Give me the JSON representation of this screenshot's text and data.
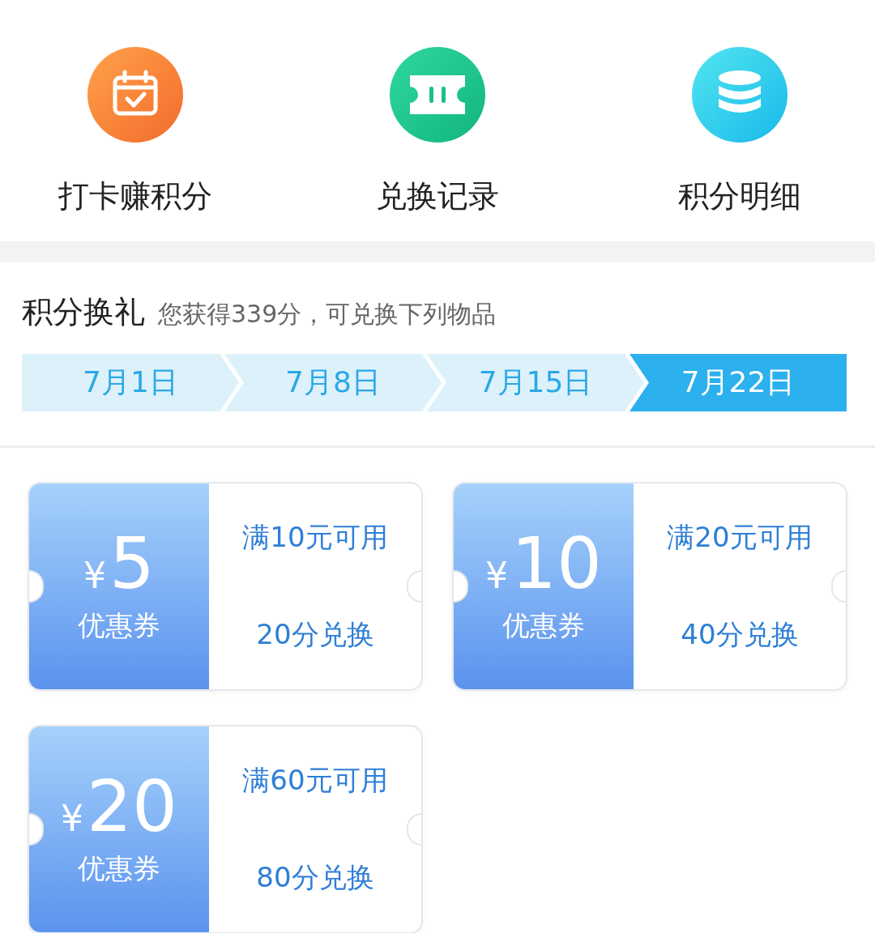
{
  "shortcuts": [
    {
      "kind": "checkin",
      "label": "打卡赚积分"
    },
    {
      "kind": "ticket",
      "label": "兑换记录"
    },
    {
      "kind": "coins",
      "label": "积分明细"
    }
  ],
  "rewards": {
    "title": "积分换礼",
    "subtitle": "您获得339分，可兑换下列物品",
    "dates": [
      {
        "label": "7月1日",
        "selected": false
      },
      {
        "label": "7月8日",
        "selected": false
      },
      {
        "label": "7月15日",
        "selected": false
      },
      {
        "label": "7月22日",
        "selected": true
      }
    ]
  },
  "coupons": [
    {
      "currency": "¥",
      "amount": "5",
      "name": "优惠券",
      "condition": "满10元可用",
      "cost": "20分兑换"
    },
    {
      "currency": "¥",
      "amount": "10",
      "name": "优惠券",
      "condition": "满20元可用",
      "cost": "40分兑换"
    },
    {
      "currency": "¥",
      "amount": "20",
      "name": "优惠券",
      "condition": "满60元可用",
      "cost": "80分兑换"
    }
  ]
}
